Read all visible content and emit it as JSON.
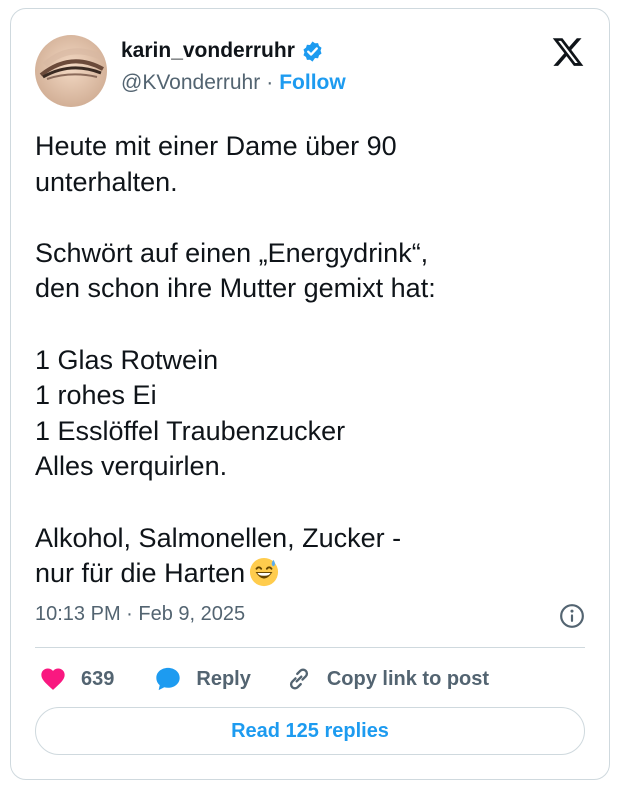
{
  "author": {
    "display_name": "karin_vonderruhr",
    "handle": "@KVonderruhr",
    "separator": "·",
    "follow_label": "Follow"
  },
  "tweet": {
    "lines": [
      "Heute mit einer Dame über 90",
      "unterhalten.",
      "",
      "Schwört auf einen „Energydrink“,",
      "den schon ihre Mutter gemixt hat:",
      "",
      "1 Glas Rotwein",
      "1 rohes Ei",
      "1 Esslöffel Traubenzucker",
      "Alles verquirlen.",
      "",
      "Alkohol, Salmonellen, Zucker -",
      "nur für die Harten"
    ],
    "emoji": "grinning-face-with-sweat-emoji"
  },
  "meta": {
    "timestamp": "10:13 PM · Feb 9, 2025"
  },
  "actions": {
    "like_count": "639",
    "reply_label": "Reply",
    "copy_label": "Copy link to post"
  },
  "read_replies_label": "Read 125 replies",
  "colors": {
    "accent": "#1d9bf0",
    "like": "#f91880",
    "text": "#0f1419",
    "muted": "#536471",
    "border": "#cfd9de"
  }
}
